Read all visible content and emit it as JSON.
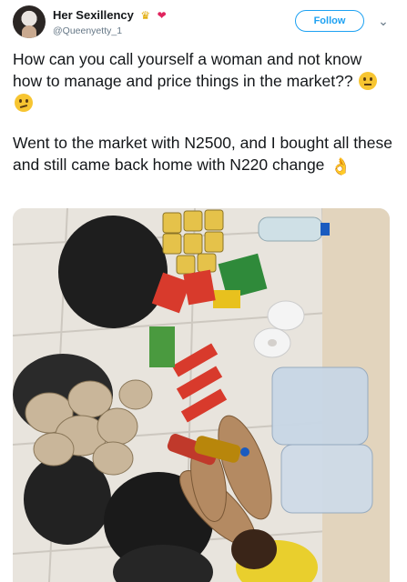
{
  "user": {
    "display_name": "Her Sexillency",
    "handle": "@Queenyetty_1",
    "badges": [
      "crown-icon",
      "heart-icon"
    ]
  },
  "actions": {
    "follow_label": "Follow",
    "menu_icon": "chevron-down-icon"
  },
  "tweet": {
    "paragraph_1": "How can you call yourself a woman and not know how to manage and price things in the market??",
    "paragraph_2": "Went to the market with N2500, and I bought all these and still came back home with N220 change",
    "emoji_1": "eye-roll-face-icon",
    "emoji_2": "confused-face-icon",
    "emoji_3": "ok-hand-icon"
  },
  "colors": {
    "accent": "#1da1f2",
    "text": "#14171a",
    "muted": "#657786"
  }
}
